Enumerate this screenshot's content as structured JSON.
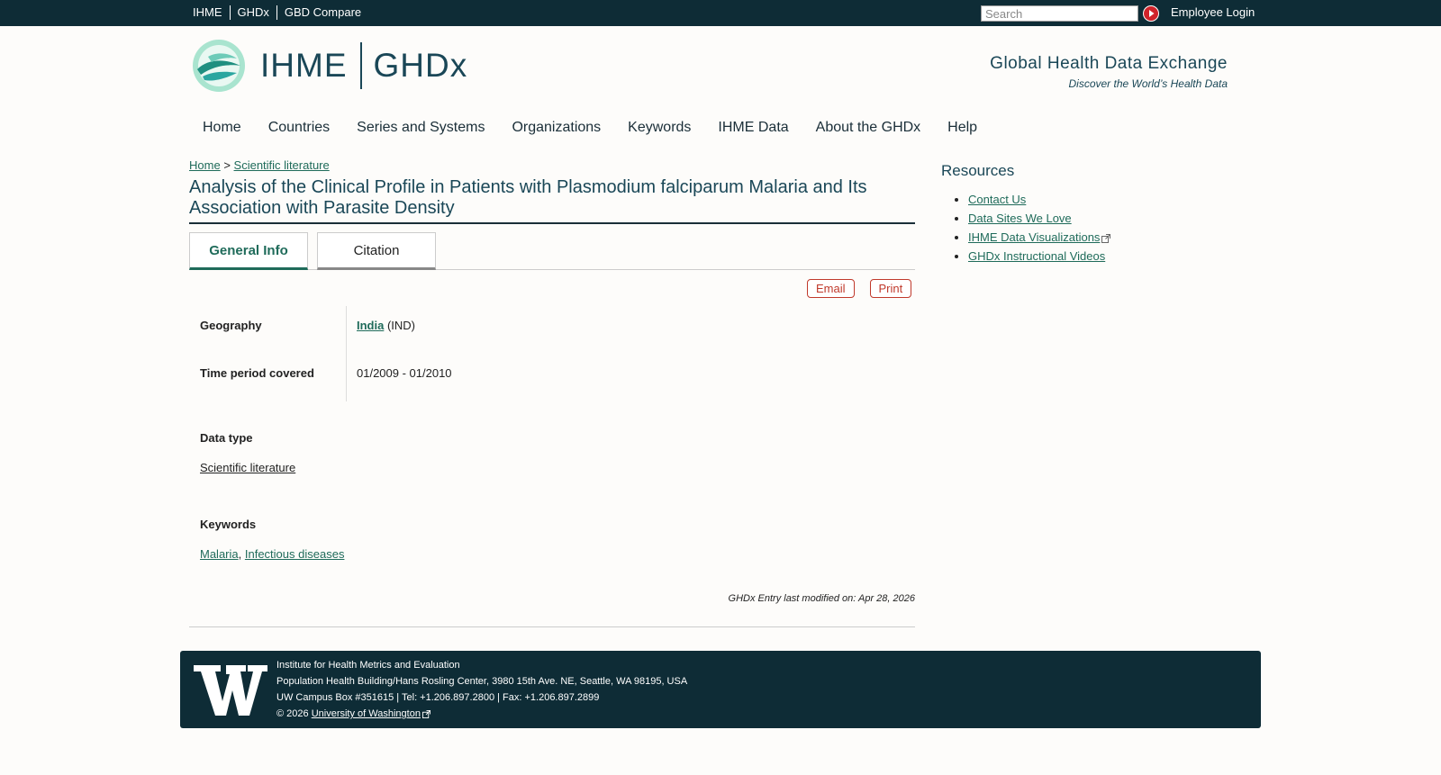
{
  "topnav": {
    "links": [
      "IHME",
      "GHDx",
      "GBD Compare"
    ],
    "search_placeholder": "Search",
    "search_icon": "play-arrow-icon",
    "employee_login": "Employee Login"
  },
  "header": {
    "brand_left": "IHME",
    "brand_right": "GHDx",
    "tagline_title": "Global Health Data Exchange",
    "tagline_sub": "Discover the World’s Health Data"
  },
  "mainnav": {
    "items": [
      "Home",
      "Countries",
      "Series and Systems",
      "Organizations",
      "Keywords",
      "IHME Data",
      "About the GHDx",
      "Help"
    ]
  },
  "breadcrumb": {
    "home": "Home",
    "separator": ">",
    "current": "Scientific literature"
  },
  "page": {
    "title": "Analysis of the Clinical Profile in Patients with Plasmodium falciparum Malaria and Its Association with Parasite Density",
    "tabs": [
      "General Info",
      "Citation"
    ],
    "actions": {
      "email": "Email",
      "print": "Print"
    },
    "geography_label": "Geography",
    "geography_link": "India",
    "geography_code": "(IND)",
    "time_label": "Time period covered",
    "time_value": "01/2009 - 01/2010",
    "datatype_label": "Data type",
    "datatype_value": "Scientific literature",
    "keywords_label": "Keywords",
    "keywords": [
      "Malaria",
      "Infectious diseases"
    ],
    "keyword_sep": ",",
    "modified": "GHDx Entry last modified on: Apr 28, 2026"
  },
  "sidebar": {
    "title": "Resources",
    "links": [
      "Contact Us",
      "Data Sites We Love",
      "IHME Data Visualizations",
      "GHDx Instructional Videos"
    ]
  },
  "footer": {
    "line1": "Institute for Health Metrics and Evaluation",
    "line2": "Population Health Building/Hans Rosling Center, 3980 15th Ave. NE, Seattle, WA 98195, USA",
    "line3": "UW Campus Box #351615 | Tel: +1.206.897.2800 | Fax: +1.206.897.2899",
    "copyright": "© 2026",
    "uw_link": "University of Washington"
  },
  "colors": {
    "topbar": "#0e2c36",
    "brand": "#1a4757",
    "link": "#1f6b5a",
    "action": "#c0392b"
  }
}
